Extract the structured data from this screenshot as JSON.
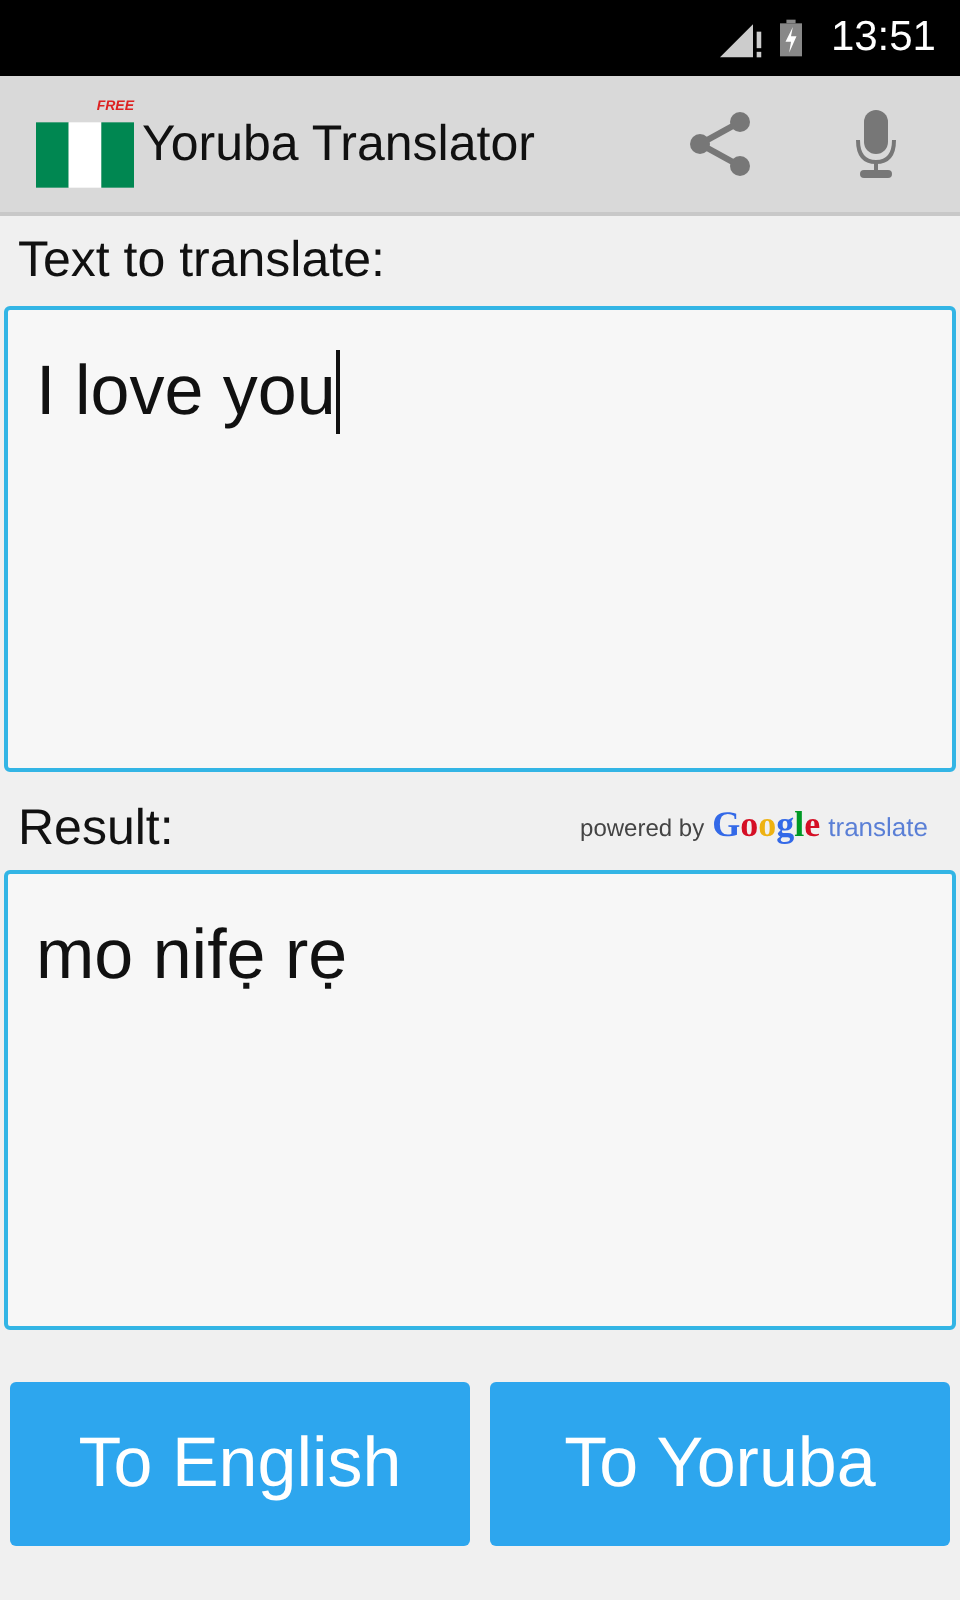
{
  "status_bar": {
    "time": "13:51"
  },
  "app_bar": {
    "badge": "FREE",
    "title": "Yoruba Translator"
  },
  "input": {
    "label": "Text to translate:",
    "value": "I love you"
  },
  "result": {
    "label": "Result:",
    "powered_by": "powered by",
    "google": "Google",
    "translate": "translate",
    "value": "mo nifẹ rẹ"
  },
  "buttons": [
    "To English",
    "To Yoruba"
  ]
}
